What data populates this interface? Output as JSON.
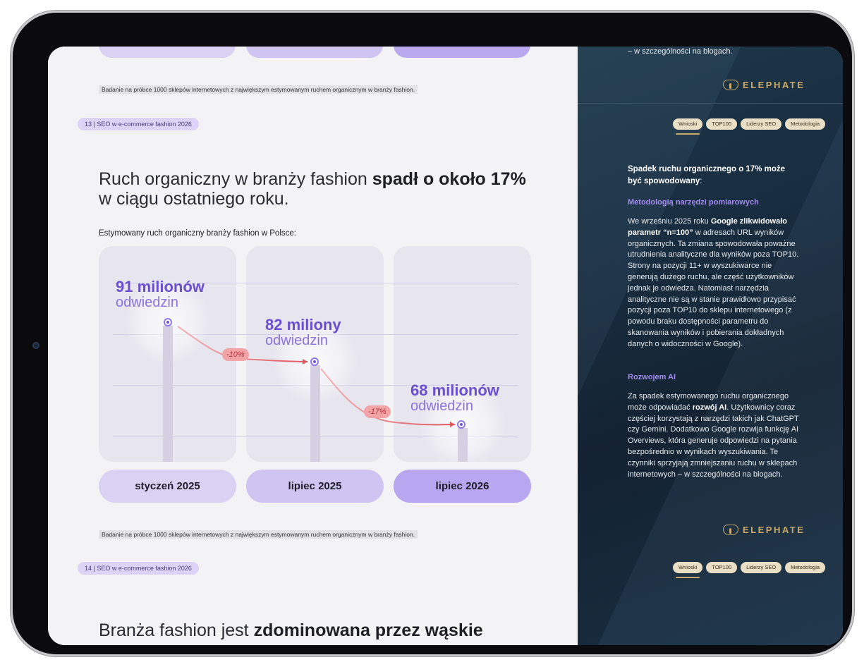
{
  "left": {
    "note1": "Badanie na próbce 1000 sklepów internetowych z największym estymowanym ruchem organicznym w branży fashion.",
    "page_tag1": "13 | SEO w e-commerce fashion 2026",
    "headline1_normal": "Ruch organiczny w branży fashion ",
    "headline1_bold": "spadł o około 17%",
    "headline1_line2": "w ciągu ostatniego roku.",
    "subtitle": "Estymowany ruch organiczny branży fashion w Polsce:",
    "stats": [
      {
        "big": "91 milionów",
        "small": "odwiedzin"
      },
      {
        "big": "82 miliony",
        "small": "odwiedzin"
      },
      {
        "big": "68 milionów",
        "small": "odwiedzin"
      }
    ],
    "changes": [
      "-10%",
      "-17%"
    ],
    "periods": [
      "styczeń 2025",
      "lipiec 2025",
      "lipiec 2026"
    ],
    "note2": "Badanie na próbce 1000 sklepów internetowych z największym estymowanym ruchem organicznym w branży fashion.",
    "page_tag2": "14 | SEO w e-commerce fashion 2026",
    "headline2_normal": "Branża fashion jest ",
    "headline2_bold": "zdominowana przez wąskie"
  },
  "chart_data": {
    "type": "line",
    "categories": [
      "styczeń 2025",
      "lipiec 2025",
      "lipiec 2026"
    ],
    "values": [
      91,
      82,
      68
    ],
    "unit": "miliony odwiedzin",
    "annotations": [
      "-10%",
      "-17%"
    ],
    "title": "Estymowany ruch organiczny branży fashion w Polsce:"
  },
  "right": {
    "top_fragment": "– w szczególności na blogach.",
    "logo": "ELEPHATE",
    "nav": [
      "Wnioski",
      "TOP100",
      "Liderzy SEO",
      "Metodologia"
    ],
    "title_main": "Spadek ruchu organicznego o 17% może być spowodowany",
    "title_colon": ":",
    "head1": "Metodologią narzędzi pomiarowych",
    "p1_a": "We wrześniu 2025 roku ",
    "p1_b": "Google zlikwidowało parametr “n=100”",
    "p1_c": " w adresach URL wyników organicznych. Ta zmiana spowodowała poważne utrudnienia analityczne dla wyników poza TOP10. Strony na pozycji 11+ w wyszukiwarce nie generują dużego ruchu, ale część użytkowników jednak je odwiedza. Natomiast narzędzia analityczne nie są w stanie prawidłowo przypisać pozycji poza TOP10 do sklepu internetowego (z powodu braku dostępności parametru do skanowania wyników i pobierania dokładnych danych o widoczności w Google).",
    "head2": "Rozwojem AI",
    "p2_a": "Za spadek estymowanego ruchu organicznego może odpowiadać ",
    "p2_b": "rozwój AI",
    "p2_c": ". Użytkownicy coraz częściej korzystają z narzędzi takich jak ChatGPT czy Gemini. Dodatkowo Google rozwija funkcję AI Overviews, która generuje odpowiedzi na pytania bezpośrednio w wynikach wyszukiwania. Te czynniki sprzyjają zmniejszaniu ruchu w sklepach internetowych – w szczególności na blogach.",
    "logo2": "ELEPHATE",
    "nav2": [
      "Wnioski",
      "TOP100",
      "Liderzy SEO",
      "Metodologia"
    ]
  }
}
